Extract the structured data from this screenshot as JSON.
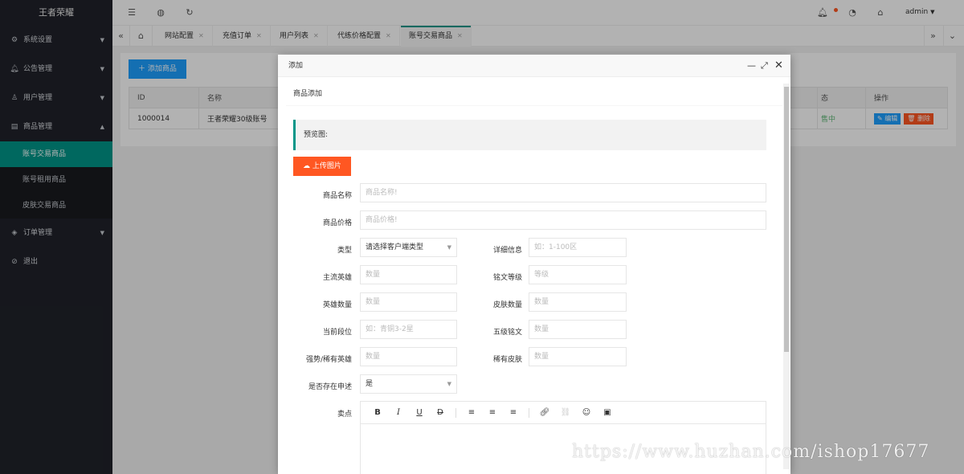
{
  "sidebar": {
    "logo": "王者荣耀",
    "items": [
      {
        "label": "系统设置",
        "icon": "gear-icon"
      },
      {
        "label": "公告管理",
        "icon": "bell-icon"
      },
      {
        "label": "用户管理",
        "icon": "user-icon"
      },
      {
        "label": "商品管理",
        "icon": "goods-icon"
      },
      {
        "label": "订单管理",
        "icon": "layers-icon"
      },
      {
        "label": "退出",
        "icon": "logout-icon"
      }
    ],
    "sub_items": [
      "账号交易商品",
      "账号租用商品",
      "皮肤交易商品"
    ]
  },
  "header": {
    "user": "admin"
  },
  "tabs": [
    "网站配置",
    "充值订单",
    "用户列表",
    "代练价格配置",
    "账号交易商品"
  ],
  "content": {
    "add_button": "添加商品",
    "columns": [
      "ID",
      "名称",
      "态",
      "操作"
    ],
    "rows": [
      {
        "id": "1000014",
        "name": "王者荣耀30级账号",
        "status": "售中"
      }
    ],
    "edit_label": "编辑",
    "delete_label": "删除"
  },
  "modal": {
    "title": "添加",
    "card_title": "商品添加",
    "preview_label": "预览图:",
    "upload_label": "上传图片",
    "fields": {
      "name_label": "商品名称",
      "name_placeholder": "商品名称!",
      "price_label": "商品价格",
      "price_placeholder": "商品价格!",
      "type_label": "类型",
      "type_value": "请选择客户端类型",
      "detail_label": "详细信息",
      "detail_placeholder": "如：1-100区",
      "hero_label": "主流英雄",
      "hero_placeholder": "数量",
      "rune_level_label": "铭文等级",
      "rune_level_placeholder": "等级",
      "hero_count_label": "英雄数量",
      "hero_count_placeholder": "数量",
      "skin_count_label": "皮肤数量",
      "skin_count_placeholder": "数量",
      "rank_label": "当前段位",
      "rank_placeholder": "如：青铜3-2星",
      "rune5_label": "五级铭文",
      "rune5_placeholder": "数量",
      "rare_hero_label": "强势/稀有英雄",
      "rare_hero_placeholder": "数量",
      "rare_skin_label": "稀有皮肤",
      "rare_skin_placeholder": "数量",
      "appeal_label": "是否存在申述",
      "appeal_value": "是",
      "selling_label": "卖点"
    }
  },
  "watermark": "https://www.huzhan.com/ishop17677"
}
